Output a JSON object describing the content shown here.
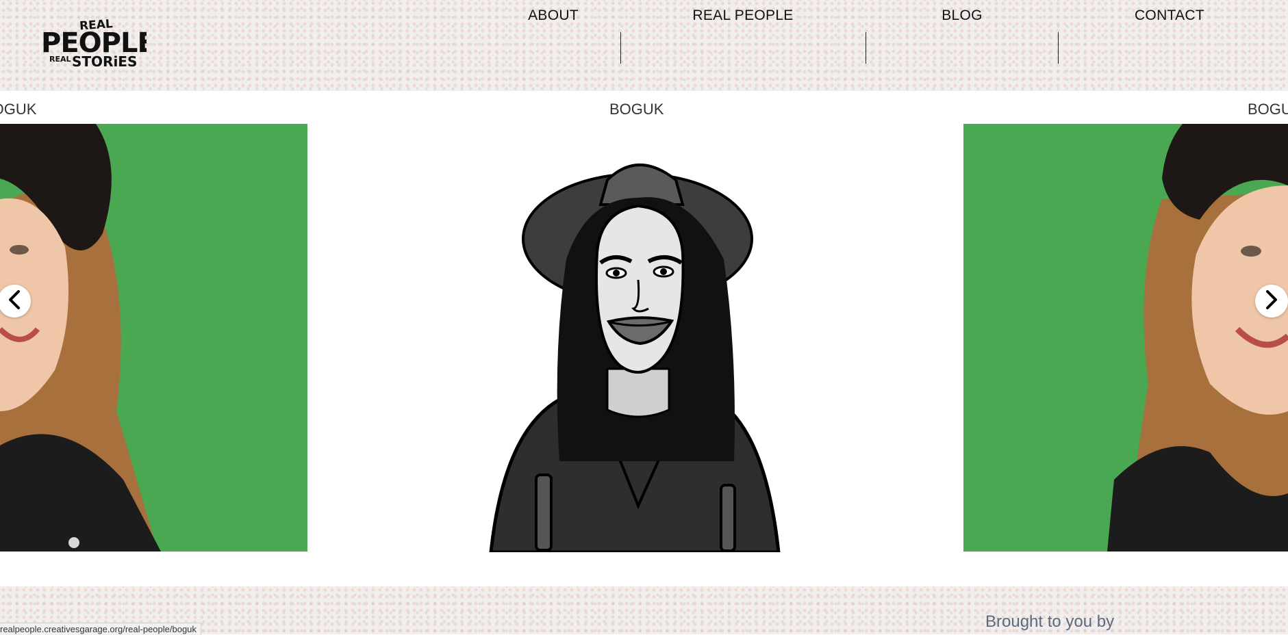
{
  "header": {
    "logo": {
      "line1": "REAL",
      "line2": "PEOPLE",
      "line3a": "REAL",
      "line3b": "STORiES",
      "icon": "real-people-real-stories-logo"
    },
    "nav": [
      {
        "label": "ABOUT"
      },
      {
        "label": "REAL PEOPLE"
      },
      {
        "label": "BLOG"
      },
      {
        "label": "CONTACT"
      }
    ]
  },
  "slider": {
    "left_title": "BOGUK",
    "center_title": "BOGUK",
    "right_title": "BOGUK",
    "prev_icon": "chevron-left-icon",
    "next_icon": "chevron-right-icon",
    "photo_bg": "#4aa853"
  },
  "footer": {
    "brought_to_you": "Brought to you by"
  },
  "status_bar": {
    "url": "realpeople.creativesgarage.org/real-people/boguk"
  }
}
